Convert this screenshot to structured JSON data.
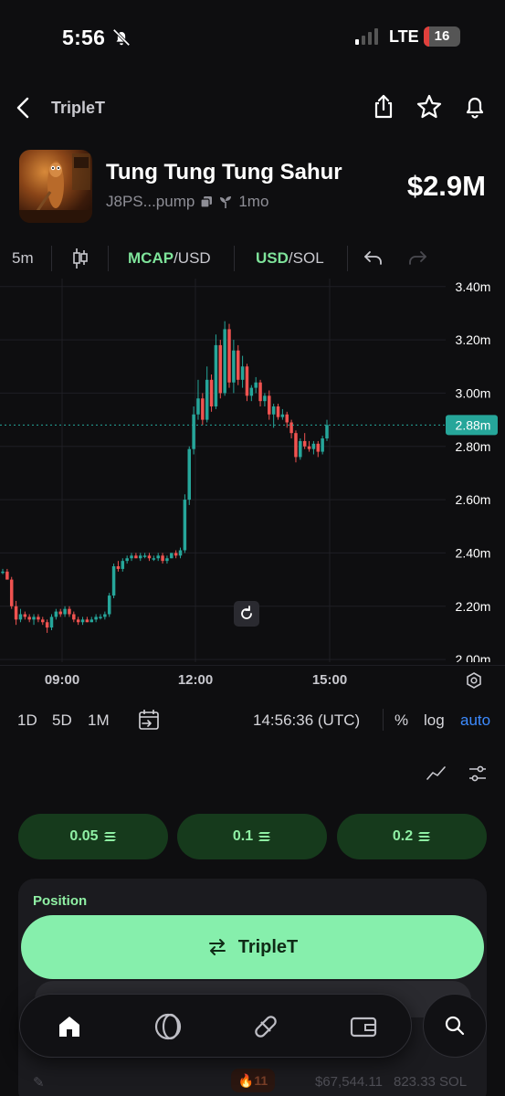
{
  "status_bar": {
    "time": "5:56",
    "network": "LTE",
    "battery": "16",
    "battery_level": 0.16
  },
  "header": {
    "title": "TripleT"
  },
  "token": {
    "name": "Tung Tung Tung Sahur",
    "address": "J8PS...pump",
    "age": "1mo",
    "market_cap": "$2.9M"
  },
  "chart_toolbar": {
    "interval": "5m",
    "mcap": "MCAP",
    "mcap_unit": "/USD",
    "usd": "USD",
    "usd_unit": "/SOL"
  },
  "chart_data": {
    "type": "candlestick",
    "price_labels": [
      "3.40m",
      "3.20m",
      "3.00m",
      "2.88m",
      "2.80m",
      "2.60m",
      "2.40m",
      "2.20m",
      "2.00m"
    ],
    "current_price_label": "2.88m",
    "y_ticks": [
      3.4,
      3.2,
      3.0,
      2.8,
      2.6,
      2.4,
      2.2,
      2.0
    ],
    "ylim": [
      1.99,
      3.43
    ],
    "current_price": 2.88,
    "x_tick_labels": [
      "09:00",
      "12:00",
      "15:00"
    ],
    "colors": {
      "up": "#26a69a",
      "down": "#ef5350",
      "current_line": "#26a69a"
    },
    "candles": [
      [
        2.33,
        2.34,
        2.32,
        2.33
      ],
      [
        2.33,
        2.34,
        2.3,
        2.3
      ],
      [
        2.3,
        2.31,
        2.19,
        2.2
      ],
      [
        2.2,
        2.22,
        2.13,
        2.15
      ],
      [
        2.15,
        2.19,
        2.14,
        2.17
      ],
      [
        2.17,
        2.18,
        2.15,
        2.16
      ],
      [
        2.16,
        2.17,
        2.14,
        2.15
      ],
      [
        2.15,
        2.17,
        2.13,
        2.16
      ],
      [
        2.16,
        2.17,
        2.14,
        2.15
      ],
      [
        2.15,
        2.16,
        2.13,
        2.14
      ],
      [
        2.14,
        2.15,
        2.1,
        2.12
      ],
      [
        2.12,
        2.17,
        2.11,
        2.16
      ],
      [
        2.16,
        2.19,
        2.15,
        2.18
      ],
      [
        2.18,
        2.19,
        2.16,
        2.17
      ],
      [
        2.17,
        2.2,
        2.16,
        2.19
      ],
      [
        2.19,
        2.2,
        2.16,
        2.17
      ],
      [
        2.17,
        2.18,
        2.14,
        2.15
      ],
      [
        2.15,
        2.16,
        2.13,
        2.14
      ],
      [
        2.14,
        2.16,
        2.13,
        2.15
      ],
      [
        2.15,
        2.16,
        2.14,
        2.14
      ],
      [
        2.14,
        2.16,
        2.14,
        2.15
      ],
      [
        2.15,
        2.17,
        2.14,
        2.16
      ],
      [
        2.16,
        2.17,
        2.15,
        2.16
      ],
      [
        2.16,
        2.18,
        2.15,
        2.17
      ],
      [
        2.17,
        2.25,
        2.16,
        2.24
      ],
      [
        2.24,
        2.36,
        2.23,
        2.35
      ],
      [
        2.35,
        2.37,
        2.33,
        2.34
      ],
      [
        2.34,
        2.38,
        2.33,
        2.37
      ],
      [
        2.37,
        2.39,
        2.36,
        2.38
      ],
      [
        2.38,
        2.4,
        2.37,
        2.39
      ],
      [
        2.39,
        2.4,
        2.38,
        2.38
      ],
      [
        2.38,
        2.4,
        2.37,
        2.39
      ],
      [
        2.39,
        2.4,
        2.38,
        2.39
      ],
      [
        2.39,
        2.4,
        2.37,
        2.38
      ],
      [
        2.38,
        2.39,
        2.37,
        2.38
      ],
      [
        2.38,
        2.4,
        2.37,
        2.39
      ],
      [
        2.39,
        2.4,
        2.36,
        2.37
      ],
      [
        2.37,
        2.39,
        2.36,
        2.38
      ],
      [
        2.38,
        2.4,
        2.38,
        2.4
      ],
      [
        2.4,
        2.41,
        2.38,
        2.39
      ],
      [
        2.39,
        2.42,
        2.38,
        2.41
      ],
      [
        2.41,
        2.62,
        2.4,
        2.6
      ],
      [
        2.6,
        2.8,
        2.58,
        2.79
      ],
      [
        2.79,
        2.95,
        2.77,
        2.92
      ],
      [
        2.92,
        3.05,
        2.9,
        2.98
      ],
      [
        2.98,
        3.0,
        2.88,
        2.9
      ],
      [
        2.9,
        3.1,
        2.89,
        3.05
      ],
      [
        3.05,
        3.07,
        2.93,
        2.95
      ],
      [
        2.95,
        3.22,
        2.94,
        3.18
      ],
      [
        3.18,
        3.2,
        2.98,
        3.0
      ],
      [
        3.0,
        3.27,
        2.99,
        3.24
      ],
      [
        3.24,
        3.26,
        3.02,
        3.04
      ],
      [
        3.04,
        3.2,
        3.0,
        3.16
      ],
      [
        3.16,
        3.18,
        3.03,
        3.05
      ],
      [
        3.05,
        3.14,
        3.02,
        3.1
      ],
      [
        3.1,
        3.11,
        2.97,
        2.99
      ],
      [
        2.99,
        3.03,
        2.97,
        3.02
      ],
      [
        3.02,
        3.06,
        3.0,
        3.04
      ],
      [
        3.04,
        3.05,
        2.95,
        2.97
      ],
      [
        2.97,
        3.0,
        2.95,
        2.99
      ],
      [
        2.99,
        3.01,
        2.9,
        2.92
      ],
      [
        2.92,
        2.96,
        2.87,
        2.95
      ],
      [
        2.95,
        2.96,
        2.9,
        2.91
      ],
      [
        2.91,
        2.94,
        2.9,
        2.92
      ],
      [
        2.92,
        2.93,
        2.87,
        2.89
      ],
      [
        2.89,
        2.9,
        2.83,
        2.85
      ],
      [
        2.85,
        2.86,
        2.74,
        2.76
      ],
      [
        2.76,
        2.83,
        2.75,
        2.82
      ],
      [
        2.82,
        2.85,
        2.79,
        2.8
      ],
      [
        2.8,
        2.82,
        2.78,
        2.79
      ],
      [
        2.79,
        2.82,
        2.77,
        2.81
      ],
      [
        2.81,
        2.82,
        2.76,
        2.78
      ],
      [
        2.78,
        2.84,
        2.77,
        2.83
      ],
      [
        2.83,
        2.9,
        2.82,
        2.88
      ]
    ]
  },
  "time_axis": {
    "t1": "09:00",
    "t2": "12:00",
    "t3": "15:00"
  },
  "range_bar": {
    "r1": "1D",
    "r2": "5D",
    "r3": "1M",
    "clock": "14:56:36 (UTC)",
    "percent": "%",
    "log": "log",
    "auto": "auto"
  },
  "amounts": [
    "0.05",
    "0.1",
    "0.2"
  ],
  "position": {
    "title": "Position",
    "trade_label": "TripleT"
  },
  "footer": {
    "flames": "11",
    "balance": "$67,544.11",
    "sol": "823.33 SOL"
  }
}
